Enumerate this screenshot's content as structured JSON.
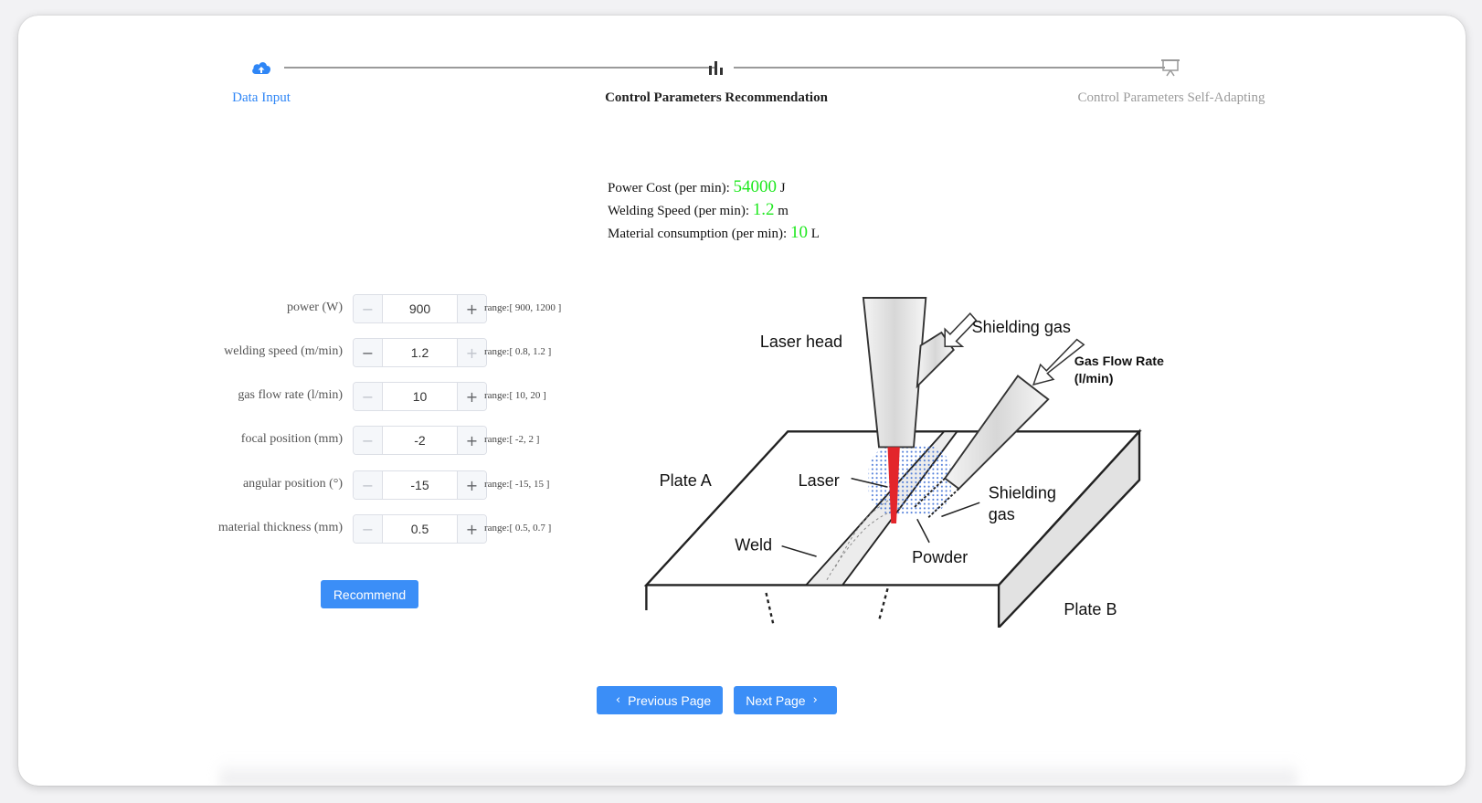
{
  "stepper": {
    "steps": [
      {
        "label": "Data Input",
        "icon": "cloud-upload-icon",
        "state": "active"
      },
      {
        "label": "Control Parameters Recommendation",
        "icon": "bar-chart-icon",
        "state": "current"
      },
      {
        "label": "Control Parameters Self-Adapting",
        "icon": "presentation-board-icon",
        "state": "pending"
      }
    ]
  },
  "metrics": {
    "power_cost_label": "Power Cost (per min):",
    "power_cost_value": "54000",
    "power_cost_unit": "J",
    "welding_speed_label": "Welding Speed (per min):",
    "welding_speed_value": "1.2",
    "welding_speed_unit": "m",
    "material_label": "Material consumption (per min):",
    "material_value": "10",
    "material_unit": "L"
  },
  "form": {
    "fields": [
      {
        "label": "power (W)",
        "value": "900",
        "range": "range:[ 900, 1200 ]"
      },
      {
        "label": "welding speed (m/min)",
        "value": "1.2",
        "range": "range:[ 0.8, 1.2 ]"
      },
      {
        "label": "gas flow rate (l/min)",
        "value": "10",
        "range": "range:[ 10, 20 ]"
      },
      {
        "label": "focal position (mm)",
        "value": "-2",
        "range": "range:[ -2, 2 ]"
      },
      {
        "label": "angular position (°)",
        "value": "-15",
        "range": "range:[ -15, 15 ]"
      },
      {
        "label": "material thickness (mm)",
        "value": "0.5",
        "range": "range:[ 0.5, 0.7 ]"
      }
    ],
    "recommend_label": "Recommend"
  },
  "diagram": {
    "laser_head": "Laser head",
    "shielding_gas_top": "Shielding gas",
    "gas_flow_rate_line1": "Gas Flow Rate",
    "gas_flow_rate_line2": "(l/min)",
    "plate_a": "Plate A",
    "plate_b": "Plate B",
    "laser": "Laser",
    "shielding_gas_line1": "Shielding",
    "shielding_gas_line2": "gas",
    "weld": "Weld",
    "powder": "Powder"
  },
  "nav": {
    "previous_label": "Previous Page",
    "next_label": "Next Page"
  },
  "colors": {
    "primary": "#3b8ef7",
    "metric_value": "#1ee81e",
    "laser_beam": "#e3262b",
    "powder_dots": "#3d6fd6"
  }
}
